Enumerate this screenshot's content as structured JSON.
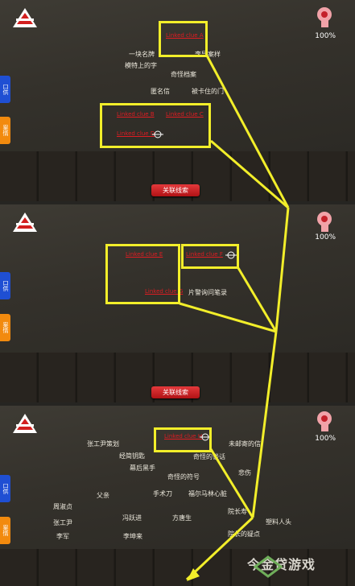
{
  "hud": {
    "percent": "100%",
    "tab_blue": "口供",
    "tab_orange": "案情",
    "link_button": "关联线索"
  },
  "panel1": {
    "clues": [
      "一块名牌",
      "李导案样",
      "模特上的字",
      "奇怪档案",
      "匿名信",
      "被卡住的门"
    ],
    "red_clues": [
      "Linked clue A",
      "Linked clue B",
      "Linked clue C",
      "Linked clue D"
    ]
  },
  "panel2": {
    "clues": [
      "片警询问笔录"
    ],
    "red_clues": [
      "Linked clue E",
      "Linked clue F",
      "Linked clue G"
    ]
  },
  "panel3": {
    "clues": [
      "张工尹策划",
      "经简钥匙",
      "未邮寄的信",
      "幕后黑手",
      "奇怪的谈话",
      "奇怪的符号",
      "悲伤",
      "父亲",
      "手术刀",
      "福尔马林心脏",
      "周淑贞",
      "张工尹",
      "冯跃进",
      "方唐生",
      "院长寿",
      "塑料人头",
      "李军",
      "李坤来",
      "院长的疑点"
    ],
    "red_clue": "Linked clue H"
  },
  "watermark": "今金贷游戏",
  "colors": {
    "highlight": "#f2ee2a",
    "red": "#e01c22",
    "tab_blue": "#1f4fd3",
    "tab_orange": "#f28a0e"
  }
}
